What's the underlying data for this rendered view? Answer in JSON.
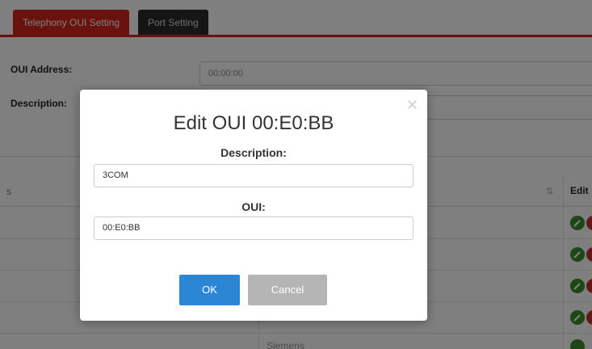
{
  "tabs": [
    {
      "label": "Telephony OUI Setting",
      "active": true
    },
    {
      "label": "Port Setting",
      "active": false
    }
  ],
  "form": {
    "oui_address_label": "OUI Address:",
    "oui_address_value": "00:00:00",
    "description_label": "Description:"
  },
  "table": {
    "header_left": "s",
    "header_edit": "Edit",
    "visible_row_text": "Siemens"
  },
  "modal": {
    "title": "Edit OUI 00:E0:BB",
    "description_label": "Description:",
    "description_value": "3COM",
    "oui_label": "OUI:",
    "oui_value": "00:E0:BB",
    "ok_label": "OK",
    "cancel_label": "Cancel"
  },
  "colors": {
    "active_tab": "#d5271c",
    "inactive_tab": "#2b2b2b",
    "ok_button": "#2b86d6",
    "cancel_button": "#b5b5b5",
    "edit_icon": "#3c8d2f",
    "delete_icon": "#c9302c"
  }
}
